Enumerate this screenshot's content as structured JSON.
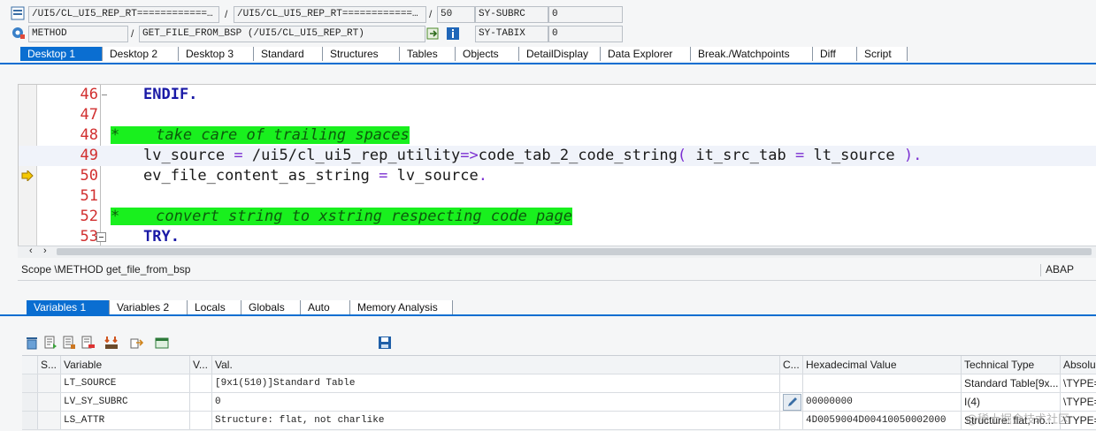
{
  "top_fields": {
    "row1": {
      "program": "/UI5/CL_UI5_REP_RT============...",
      "include": "/UI5/CL_UI5_REP_RT=============...",
      "line": "50",
      "sy_subrc_label": "SY-SUBRC",
      "sy_subrc_value": "0"
    },
    "row2": {
      "type": "METHOD",
      "method": "GET_FILE_FROM_BSP (/UI5/CL_UI5_REP_RT)",
      "sy_tabix_label": "SY-TABIX",
      "sy_tabix_value": "0"
    },
    "separator": "/"
  },
  "desktop_tabs": [
    "Desktop 1",
    "Desktop 2",
    "Desktop 3",
    "Standard",
    "Structures",
    "Tables",
    "Objects",
    "DetailDisplay",
    "Data Explorer",
    "Break./Watchpoints",
    "Diff",
    "Script"
  ],
  "editor": {
    "lines": [
      {
        "num": "46",
        "t": [
          "ENDIF."
        ]
      },
      {
        "num": "47",
        "t": []
      },
      {
        "num": "48",
        "t": [
          "*    take care of trailing spaces"
        ]
      },
      {
        "num": "49",
        "t": [
          "lv_source",
          " = ",
          "/ui5/cl_ui5_rep_utility",
          "=>",
          "code_tab_2_code_string",
          "( ",
          "it_src_tab",
          " = ",
          "lt_source",
          " )."
        ]
      },
      {
        "num": "50",
        "t": [
          "ev_file_content_as_string",
          " = ",
          "lv_source",
          "."
        ]
      },
      {
        "num": "51",
        "t": []
      },
      {
        "num": "52",
        "t": [
          "*    convert string to xstring respecting code page"
        ]
      },
      {
        "num": "53",
        "t": [
          "TRY."
        ]
      }
    ]
  },
  "status": {
    "scope": "Scope \\METHOD get_file_from_bsp",
    "language": "ABAP"
  },
  "var_tabs": [
    "Variables 1",
    "Variables 2",
    "Locals",
    "Globals",
    "Auto",
    "Memory Analysis"
  ],
  "grid": {
    "headers": [
      "S...",
      "Variable",
      "V...",
      "Val.",
      "C...",
      "Hexadecimal Value",
      "Technical Type",
      "Absolu"
    ],
    "rows": [
      {
        "variable": "LT_SOURCE",
        "value": "[9x1(510)]Standard Table",
        "hex": "",
        "type": "Standard Table[9x...",
        "abs": "\\TYPE="
      },
      {
        "variable": "LV_SY_SUBRC",
        "value": "0",
        "hex": "00000000",
        "type": "I(4)",
        "abs": "\\TYPE="
      },
      {
        "variable": "LS_ATTR",
        "value": "Structure: flat, not charlike",
        "hex": "4D0059004D00410050002000",
        "type": "Structure: flat, no...",
        "abs": "\\TYPE="
      }
    ]
  },
  "watermark": "@稀土掘金技术社区",
  "colors": {
    "accent": "#0a6ed1",
    "comment_bg": "#19f01e",
    "line_number": "#d12f2f",
    "keyword": "#1a1aa6"
  }
}
